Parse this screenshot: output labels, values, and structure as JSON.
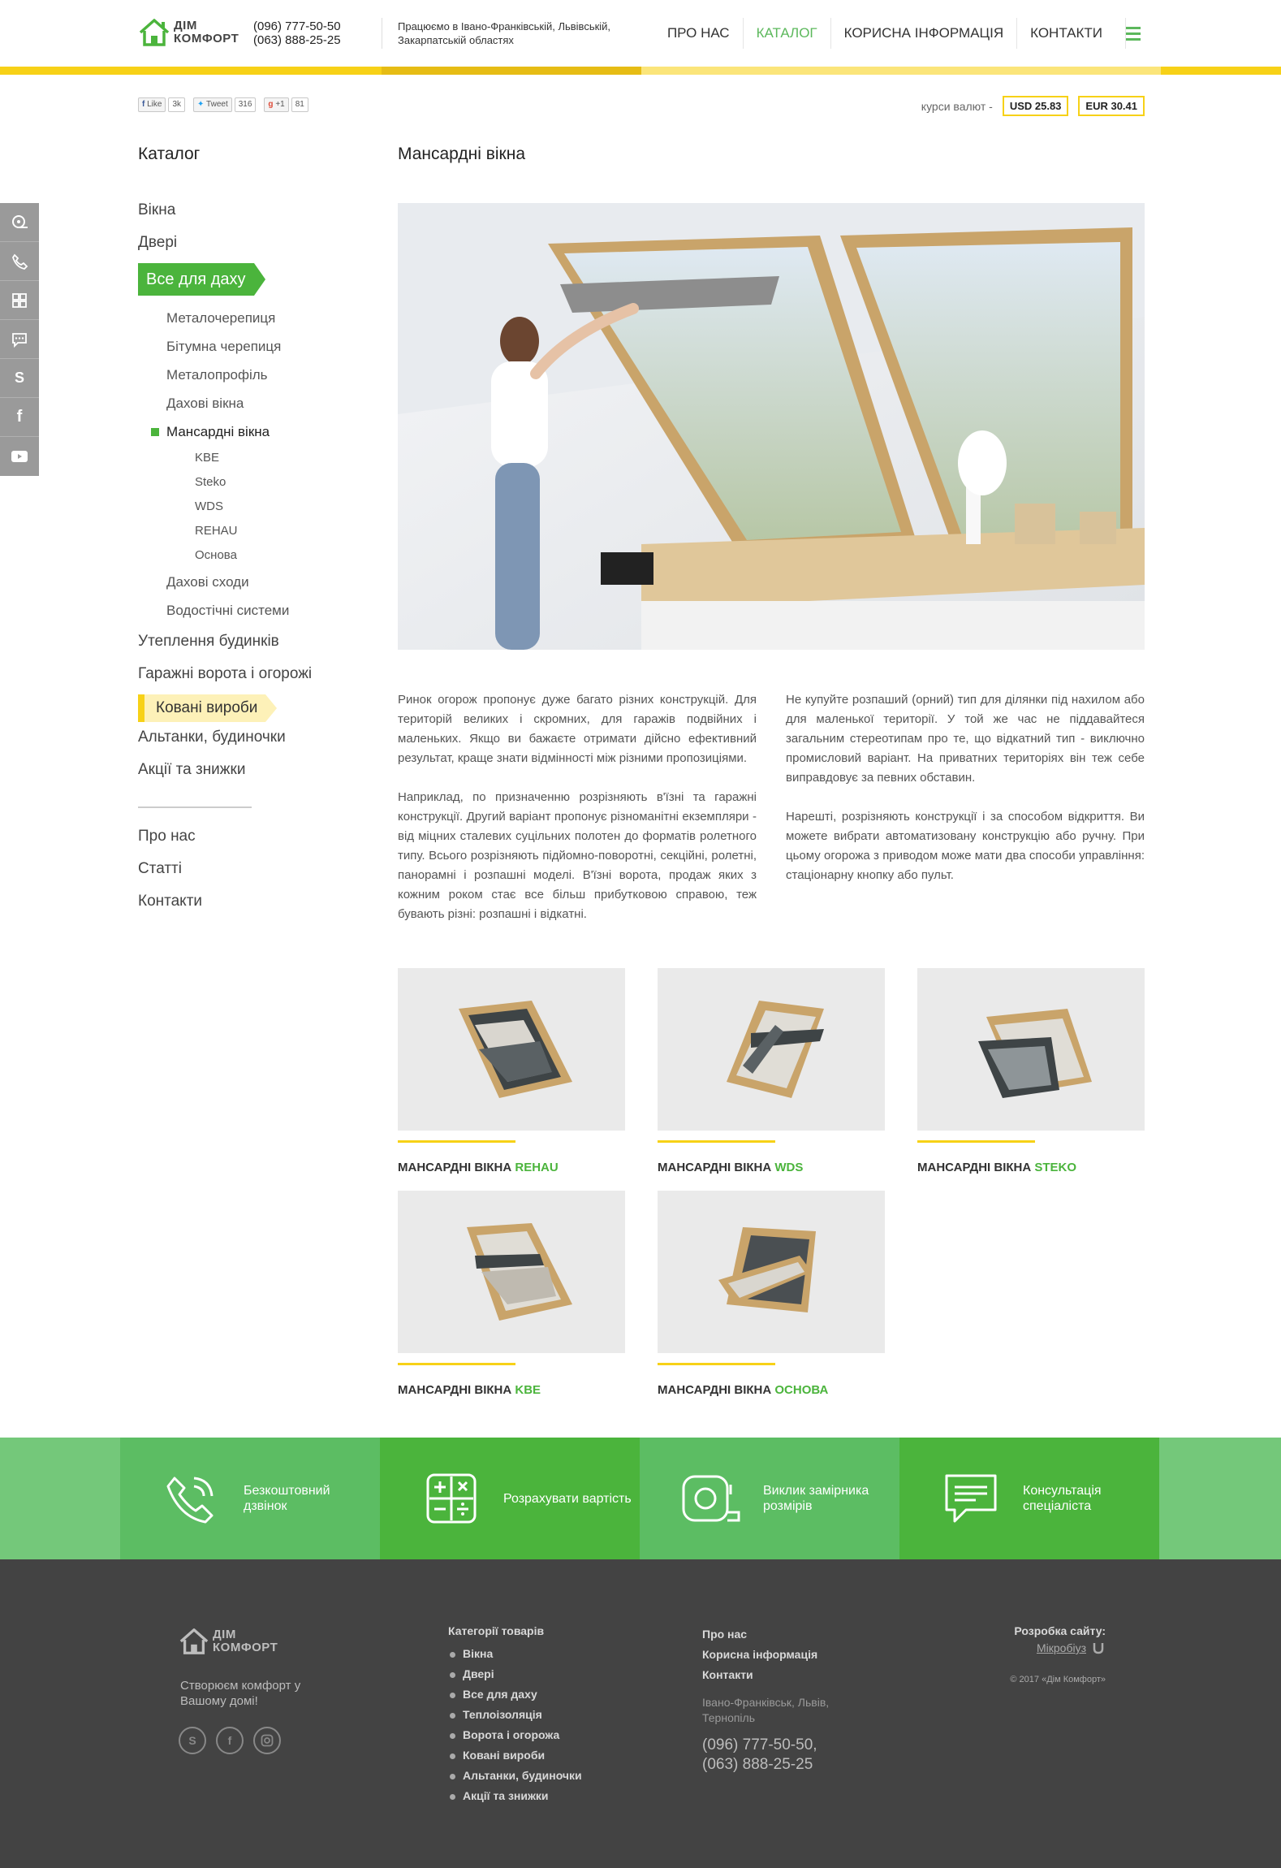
{
  "header": {
    "logo_line1": "ДІМ",
    "logo_line2": "КОМФОРТ",
    "phone1": "(096) 777-50-50",
    "phone2": "(063) 888-25-25",
    "regions": "Працюємо в Івано-Франківській, Львівській, Закарпатській областях",
    "nav": [
      {
        "label": "ПРО НАС"
      },
      {
        "label": "КАТАЛОГ"
      },
      {
        "label": "КОРИСНА ІНФОРМАЦІЯ"
      },
      {
        "label": "КОНТАКТИ"
      }
    ],
    "accent_color": "#4bb43c",
    "bar_colors": [
      "#f7d117",
      "#e6bc14",
      "#fbe57a",
      "#f7d117"
    ]
  },
  "share": {
    "fb_label": "Like",
    "fb_count": "3k",
    "tw_label": "Tweet",
    "tw_count": "316",
    "gp_label": "+1",
    "gp_count": "81"
  },
  "rates": {
    "label": "курси валют -",
    "usd": "USD 25.83",
    "eur": "EUR 30.41"
  },
  "catalog": {
    "title": "Каталог",
    "top_items": [
      {
        "label": "Вікна"
      },
      {
        "label": "Двері"
      }
    ],
    "active": "Все для даху",
    "sub_items": [
      {
        "label": "Металочерепиця"
      },
      {
        "label": "Бітумна черепиця"
      },
      {
        "label": "Металопрофіль"
      },
      {
        "label": "Дахові вікна"
      }
    ],
    "sub_active": "Мансардні вікна",
    "subsub_items": [
      {
        "label": "KBE"
      },
      {
        "label": "Steko"
      },
      {
        "label": "WDS"
      },
      {
        "label": "REHAU"
      },
      {
        "label": "Основа"
      }
    ],
    "sub_items_after": [
      {
        "label": "Дахові сходи"
      },
      {
        "label": "Водостічні системи"
      }
    ],
    "items_after": [
      {
        "label": "Утеплення будинків"
      },
      {
        "label": "Гаражні ворота і огорожі"
      }
    ],
    "hovered": "Ковані вироби",
    "items_after_hover": [
      {
        "label": "Альтанки, будиночки"
      },
      {
        "label": "Акції та знижки"
      }
    ],
    "secondary": [
      {
        "label": "Про нас"
      },
      {
        "label": "Статті"
      },
      {
        "label": "Контакти"
      }
    ]
  },
  "main": {
    "title": "Мансардні вікна",
    "col1_p1": "Ринок огорож пропонує дуже багато різних конструкцій. Для територій великих і скромних, для гаражів подвійних і маленьких. Якщо ви бажаєте отримати дійсно ефективний результат, краще знати відмінності між різними пропозиціями.",
    "col1_p2": "Наприклад, по призначенню розрізняють в'їзні та гаражні конструкції. Другий варіант пропонує різноманітні екземпляри - від міцних сталевих суцільних полотен до форматів ролетного типу. Всього розрізняють підйомно-поворотні, секційні, ролетні, панорамні і розпашні моделі. В'їзні ворота, продаж яких з кожним роком стає все більш прибутковою справою, теж бувають різні: розпашні і відкатні.",
    "col2_p1": "Не купуйте розпаший (орний) тип для ділянки під нахилом або для маленької території. У той же час не піддавайтеся загальним стереотипам про те, що відкатний тип - виключно промисловий варіант. На приватних територіях він теж себе виправдовує за певних обставин.",
    "col2_p2": "Нарешті, розрізняють конструкції і за способом відкриття. Ви можете вибрати автоматизовану конструкцію або ручну. При цьому огорожа з приводом може мати два способи управління: стаціонарну кнопку або пульт."
  },
  "products": [
    {
      "prefix": "МАНСАРДНІ ВІКНА",
      "brand": "REHAU"
    },
    {
      "prefix": "МАНСАРДНІ ВІКНА",
      "brand": "WDS"
    },
    {
      "prefix": "МАНСАРДНІ ВІКНА",
      "brand": "STEKO"
    },
    {
      "prefix": "МАНСАРДНІ ВІКНА",
      "brand": "KBE"
    },
    {
      "prefix": "МАНСАРДНІ ВІКНА",
      "brand": "ОСНОВА"
    }
  ],
  "band": {
    "items": [
      {
        "label": "Безкоштовний дзвінок",
        "icon": "phone-icon",
        "color": "#5cbd63"
      },
      {
        "label": "Розрахувати вартість",
        "icon": "calculator-icon",
        "color": "#4bb43c"
      },
      {
        "label": "Виклик замірника розмірів",
        "icon": "tape-measure-icon",
        "color": "#5cbd63"
      },
      {
        "label": "Консультація спеціаліста",
        "icon": "chat-icon",
        "color": "#4bb43c"
      }
    ]
  },
  "footer": {
    "logo_line1": "ДІМ",
    "logo_line2": "КОМФОРТ",
    "slogan": "Створюєм комфорт у Вашому домі!",
    "cats_head": "Категорії товарів",
    "cats": [
      {
        "label": "Вікна"
      },
      {
        "label": "Двері"
      },
      {
        "label": "Все для даху"
      },
      {
        "label": "Теплоізоляція"
      },
      {
        "label": "Ворота і огорожа"
      },
      {
        "label": "Ковані вироби"
      },
      {
        "label": "Альтанки, будиночки"
      },
      {
        "label": "Акції та знижки"
      }
    ],
    "links": [
      {
        "label": "Про нас"
      },
      {
        "label": "Корисна інформація"
      },
      {
        "label": "Контакти"
      }
    ],
    "address": "Івано-Франківськ, Львів, Тернопіль",
    "phone1": "(096) 777-50-50,",
    "phone2": "(063) 888-25-25",
    "dev_head": "Розробка сайту:",
    "dev_link": "Мікробіуз",
    "copyright": "© 2017 «Дім Комфорт»"
  }
}
